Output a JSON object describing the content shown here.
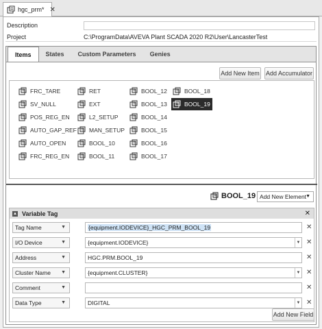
{
  "doc_tab": {
    "title": "hgc_prm*",
    "close": "✕"
  },
  "header": {
    "description_label": "Description",
    "description_value": "",
    "project_label": "Project",
    "project_value": "C:\\ProgramData\\AVEVA Plant SCADA 2020 R2\\User\\LancasterTest"
  },
  "tabs": [
    {
      "label": "Items",
      "active": true
    },
    {
      "label": "States",
      "active": false
    },
    {
      "label": "Custom Parameters",
      "active": false
    },
    {
      "label": "Genies",
      "active": false
    }
  ],
  "toolbar": {
    "add_item_label": "Add New Item",
    "add_accumulator_label": "Add Accumulator"
  },
  "items": {
    "col1": [
      "FRC_TARE",
      "SV_NULL",
      "POS_REG_EN",
      "AUTO_GAP_REF",
      "AUTO_OPEN",
      "FRC_REG_EN"
    ],
    "col2": [
      "RET",
      "EXT",
      "L2_SETUP",
      "MAN_SETUP",
      "BOOL_10",
      "BOOL_11"
    ],
    "col3": [
      "BOOL_12",
      "BOOL_13",
      "BOOL_14",
      "BOOL_15",
      "BOOL_16",
      "BOOL_17"
    ],
    "col4": [
      "BOOL_18",
      "BOOL_19"
    ],
    "selected": "BOOL_19"
  },
  "selected_item": {
    "name": "BOOL_19",
    "add_element_label": "Add New Element"
  },
  "variable_tag": {
    "title": "Variable Tag",
    "remove": "✕",
    "rows": [
      {
        "name": "Tag Name",
        "value": "{equipment.IODEVICE}_HGC_PRM_BOOL_19",
        "combo": false,
        "highlight": true
      },
      {
        "name": "I/O Device",
        "value": "{equipment.IODEVICE}",
        "combo": true,
        "highlight": false
      },
      {
        "name": "Address",
        "value": "HGC.PRM.BOOL_19",
        "combo": false,
        "highlight": false
      },
      {
        "name": "Cluster Name",
        "value": "{equipment.CLUSTER}",
        "combo": true,
        "highlight": false
      },
      {
        "name": "Comment",
        "value": "",
        "combo": false,
        "highlight": false
      },
      {
        "name": "Data Type",
        "value": "DIGITAL",
        "combo": true,
        "highlight": false
      }
    ],
    "add_field_label": "Add New Field",
    "delete_glyph": "✕"
  },
  "colors": {
    "selected_item_bg": "#2b2b2b",
    "highlight": "#cfe3f6",
    "section_header": "#dedede"
  },
  "icons": {
    "tag": "tag-icon",
    "dropdown": "chevron-down-icon",
    "section_toggle": "collapse-icon"
  }
}
